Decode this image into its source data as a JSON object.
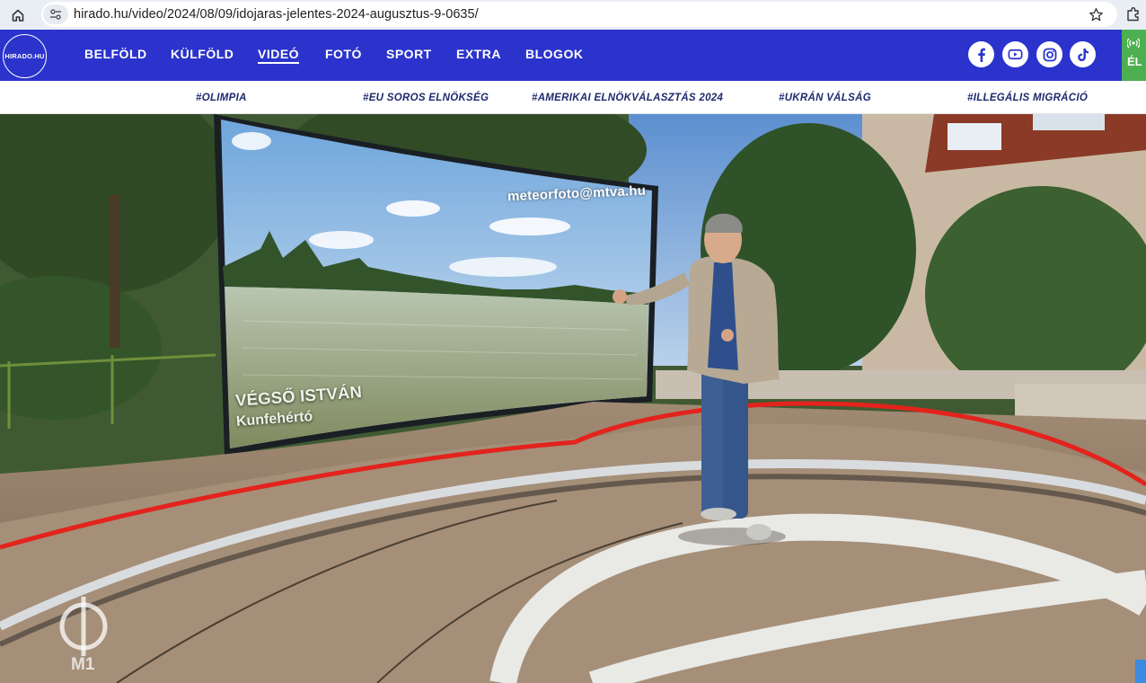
{
  "browser": {
    "url": "hirado.hu/video/2024/08/09/idojaras-jelentes-2024-augusztus-9-0635/",
    "icons": [
      "home-icon",
      "site-info-icon",
      "star-icon",
      "extensions-icon"
    ]
  },
  "site": {
    "logo_text": "HIRADO.HU",
    "nav": [
      {
        "label": "BELFÖLD",
        "active": false
      },
      {
        "label": "KÜLFÖLD",
        "active": false
      },
      {
        "label": "VIDEÓ",
        "active": true
      },
      {
        "label": "FOTÓ",
        "active": false
      },
      {
        "label": "SPORT",
        "active": false
      },
      {
        "label": "EXTRA",
        "active": false
      },
      {
        "label": "BLOGOK",
        "active": false
      }
    ],
    "social": [
      "facebook-icon",
      "youtube-icon",
      "instagram-icon",
      "tiktok-icon"
    ],
    "live_badge": "ÉL",
    "brand_color": "#2b33cc"
  },
  "hashtags": [
    "#OLIMPIA",
    "#EU SOROS ELNÖKSÉG",
    "#AMERIKAI ELNÖKVÁLASZTÁS 2024",
    "#UKRÁN VÁLSÁG",
    "#ILLEGÁLIS MIGRÁCIÓ"
  ],
  "video": {
    "watermark": "meteorfoto@mtva.hu",
    "photographer": "VÉGSŐ ISTVÁN",
    "location": "Kunfehértó",
    "channel": "M1"
  }
}
